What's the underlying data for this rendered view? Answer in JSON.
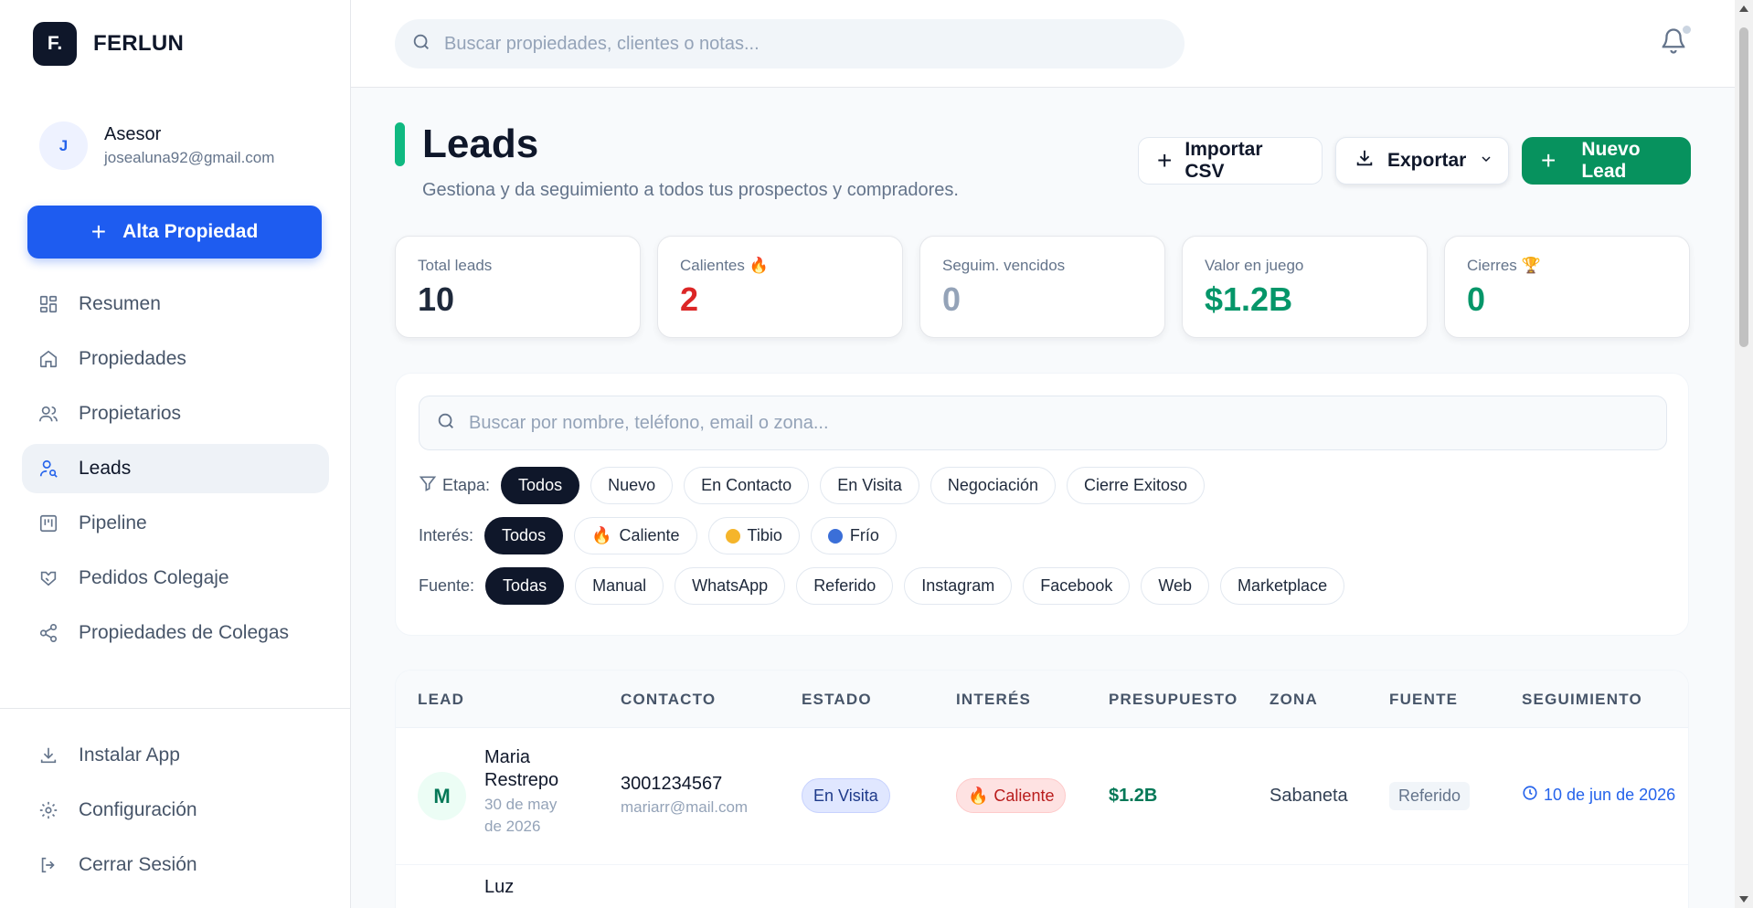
{
  "brand": {
    "logo": "F.",
    "name": "FERLUN"
  },
  "profile": {
    "initial": "J",
    "role": "Asesor",
    "email": "josealuna92@gmail.com"
  },
  "sidebar": {
    "cta": "Alta Propiedad",
    "items": [
      {
        "label": "Resumen",
        "icon": "grid-icon"
      },
      {
        "label": "Propiedades",
        "icon": "home-icon"
      },
      {
        "label": "Propietarios",
        "icon": "users-icon"
      },
      {
        "label": "Leads",
        "icon": "user-search-icon",
        "active": true
      },
      {
        "label": "Pipeline",
        "icon": "kanban-icon"
      },
      {
        "label": "Pedidos Colegaje",
        "icon": "handshake-icon"
      },
      {
        "label": "Propiedades de Colegas",
        "icon": "share-icon"
      }
    ],
    "bottom": [
      {
        "label": "Instalar App",
        "icon": "download-icon"
      },
      {
        "label": "Configuración",
        "icon": "gear-icon"
      },
      {
        "label": "Cerrar Sesión",
        "icon": "logout-icon"
      }
    ]
  },
  "topbar": {
    "search_placeholder": "Buscar propiedades, clientes o notas..."
  },
  "header": {
    "title": "Leads",
    "subtitle": "Gestiona y da seguimiento a todos tus prospectos y compradores.",
    "import": "Importar CSV",
    "export": "Exportar",
    "new": "Nuevo Lead"
  },
  "stats": [
    {
      "label": "Total leads",
      "value": "10",
      "color": "#1e293b"
    },
    {
      "label": "Calientes 🔥",
      "value": "2",
      "color": "#dc2626"
    },
    {
      "label": "Seguim. vencidos",
      "value": "0",
      "color": "#94a3b8"
    },
    {
      "label": "Valor en juego",
      "value": "$1.2B",
      "color": "#059669"
    },
    {
      "label": "Cierres 🏆",
      "value": "0",
      "color": "#059669"
    }
  ],
  "filters": {
    "search_placeholder": "Buscar por nombre, teléfono, email o zona...",
    "stage_label": "Etapa:",
    "stages": [
      "Todos",
      "Nuevo",
      "En Contacto",
      "En Visita",
      "Negociación",
      "Cierre Exitoso"
    ],
    "interest_label": "Interés:",
    "interests": [
      {
        "label": "Todos"
      },
      {
        "label": "Caliente",
        "icon": "🔥"
      },
      {
        "label": "Tibio",
        "dot": "#f59e0b"
      },
      {
        "label": "Frío",
        "dot": "#3b82f6"
      }
    ],
    "source_label": "Fuente:",
    "sources": [
      "Todas",
      "Manual",
      "WhatsApp",
      "Referido",
      "Instagram",
      "Facebook",
      "Web",
      "Marketplace"
    ]
  },
  "table": {
    "headers": [
      "LEAD",
      "CONTACTO",
      "ESTADO",
      "INTERÉS",
      "PRESUPUESTO",
      "ZONA",
      "FUENTE",
      "SEGUIMIENTO"
    ],
    "rows": [
      {
        "initial": "M",
        "name": "Maria Restrepo",
        "date": "30 de may de 2026",
        "phone": "3001234567",
        "email": "mariarr@mail.com",
        "state": "En Visita",
        "interest": "Caliente",
        "budget": "$1.2B",
        "zone": "Sabaneta",
        "source": "Referido",
        "followup": "10 de jun de 2026"
      },
      {
        "name": "Luz"
      }
    ]
  }
}
